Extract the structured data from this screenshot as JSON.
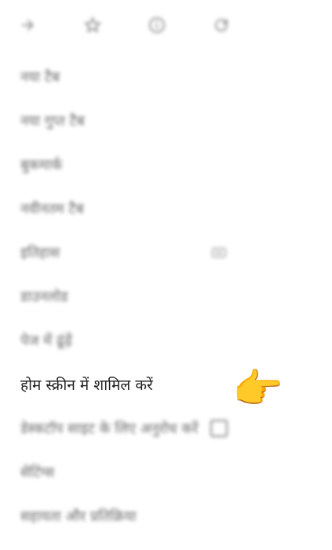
{
  "toolbar": {
    "icons": [
      "forward-icon",
      "star-icon",
      "info-icon",
      "reload-icon"
    ]
  },
  "menu": {
    "items": [
      {
        "label": "नया टैब"
      },
      {
        "label": "नया गुप्त टैब"
      },
      {
        "label": "बुकमार्क"
      },
      {
        "label": "नवीनतम टैब"
      },
      {
        "label": "इतिहास"
      },
      {
        "label": "डाउनलोड"
      },
      {
        "label": "पेज में ढूंढ़ें"
      },
      {
        "label": "होम स्क्रीन में शामिल करें"
      },
      {
        "label": "डेस्कटॉप साइट के लिए अनुरोध करें"
      },
      {
        "label": "सेटिंग्स"
      },
      {
        "label": "सहायता और प्रतिक्रिया"
      }
    ]
  },
  "pointer": {
    "emoji": "👉"
  },
  "colors": {
    "text": "#1f1f1f",
    "icon": "#6b6b6b",
    "background": "#ffffff"
  }
}
